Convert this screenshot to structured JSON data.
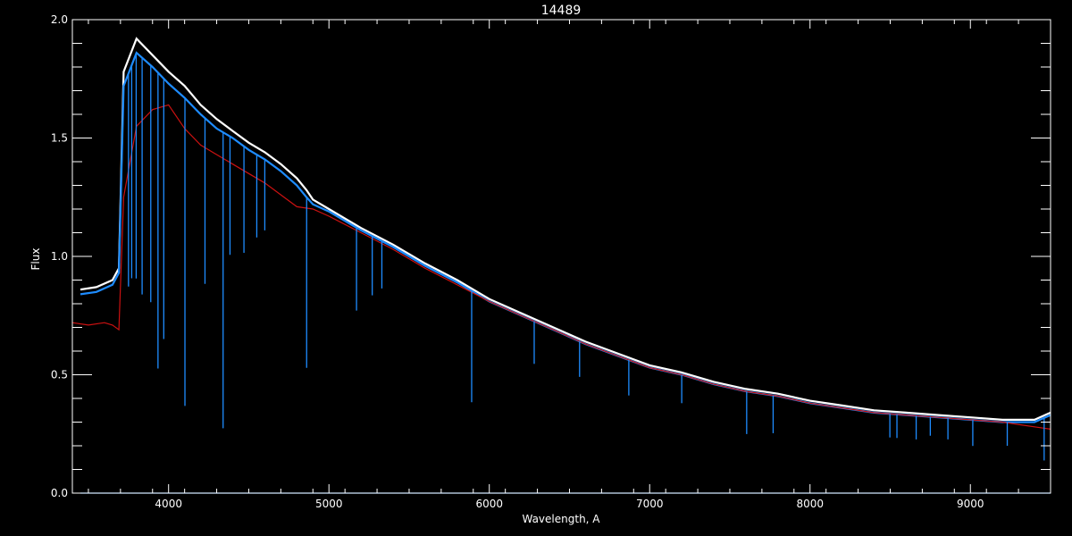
{
  "chart_data": {
    "type": "line",
    "title": "14489",
    "xlabel": "Wavelength, A",
    "ylabel": "Flux",
    "xlim": [
      3400,
      9500
    ],
    "ylim": [
      0.0,
      2.0
    ],
    "x_ticks": [
      4000,
      5000,
      6000,
      7000,
      8000,
      9000
    ],
    "x_tick_labels": [
      "4000",
      "5000",
      "6000",
      "7000",
      "8000",
      "9000"
    ],
    "y_ticks": [
      0.0,
      0.5,
      1.0,
      1.5,
      2.0
    ],
    "y_tick_labels": [
      "0.0",
      "0.5",
      "1.0",
      "1.5",
      "2.0"
    ],
    "grid": false,
    "colors": {
      "background": "#000000",
      "axes": "#ffffff",
      "observed_upper": "#ffffff",
      "observed": "#1e8cff",
      "model": "#cc1111",
      "error": "#1e8cff"
    },
    "series": [
      {
        "color": "#ffffff",
        "x": [
          3450,
          3550,
          3650,
          3690,
          3720,
          3800,
          3900,
          4000,
          4100,
          4200,
          4300,
          4400,
          4500,
          4600,
          4700,
          4800,
          4860,
          4900,
          5000,
          5200,
          5400,
          5600,
          5800,
          6000,
          6200,
          6400,
          6600,
          6800,
          7000,
          7200,
          7400,
          7600,
          7800,
          8000,
          8200,
          8400,
          8600,
          8800,
          9000,
          9200,
          9400,
          9500
        ],
        "y": [
          0.86,
          0.87,
          0.9,
          0.95,
          1.78,
          1.92,
          1.85,
          1.78,
          1.72,
          1.64,
          1.58,
          1.53,
          1.48,
          1.44,
          1.39,
          1.33,
          1.28,
          1.24,
          1.2,
          1.12,
          1.05,
          0.97,
          0.9,
          0.82,
          0.76,
          0.7,
          0.64,
          0.59,
          0.54,
          0.51,
          0.47,
          0.44,
          0.42,
          0.39,
          0.37,
          0.35,
          0.34,
          0.33,
          0.32,
          0.31,
          0.31,
          0.34
        ]
      },
      {
        "color": "#1e8cff",
        "x": [
          3450,
          3550,
          3650,
          3690,
          3720,
          3800,
          3900,
          4000,
          4100,
          4200,
          4300,
          4400,
          4500,
          4600,
          4700,
          4800,
          4860,
          4900,
          5000,
          5200,
          5400,
          5600,
          5800,
          6000,
          6200,
          6400,
          6600,
          6800,
          7000,
          7200,
          7400,
          7600,
          7800,
          8000,
          8200,
          8400,
          8600,
          8800,
          9000,
          9200,
          9400,
          9500
        ],
        "y": [
          0.84,
          0.85,
          0.88,
          0.93,
          1.72,
          1.86,
          1.8,
          1.73,
          1.67,
          1.6,
          1.54,
          1.5,
          1.45,
          1.41,
          1.36,
          1.3,
          1.25,
          1.22,
          1.19,
          1.11,
          1.04,
          0.96,
          0.89,
          0.81,
          0.75,
          0.69,
          0.63,
          0.58,
          0.53,
          0.5,
          0.46,
          0.43,
          0.41,
          0.38,
          0.36,
          0.34,
          0.33,
          0.32,
          0.31,
          0.3,
          0.3,
          0.33
        ]
      },
      {
        "color": "#cc1111",
        "x": [
          3400,
          3500,
          3600,
          3650,
          3690,
          3720,
          3800,
          3900,
          4000,
          4100,
          4200,
          4300,
          4400,
          4500,
          4600,
          4700,
          4800,
          4900,
          5000,
          5200,
          5400,
          5600,
          5800,
          6000,
          6200,
          6400,
          6600,
          6800,
          7000,
          7200,
          7400,
          7600,
          7800,
          8000,
          8200,
          8400,
          8600,
          8800,
          9000,
          9200,
          9400,
          9500
        ],
        "y": [
          0.72,
          0.71,
          0.72,
          0.71,
          0.69,
          1.25,
          1.55,
          1.62,
          1.64,
          1.54,
          1.47,
          1.43,
          1.39,
          1.35,
          1.31,
          1.26,
          1.21,
          1.2,
          1.17,
          1.1,
          1.03,
          0.95,
          0.88,
          0.81,
          0.75,
          0.69,
          0.63,
          0.58,
          0.53,
          0.5,
          0.46,
          0.43,
          0.41,
          0.38,
          0.36,
          0.34,
          0.33,
          0.32,
          0.31,
          0.3,
          0.28,
          0.27
        ]
      },
      {
        "color": "#1e8cff",
        "x": [
          3450,
          9500
        ],
        "y": [
          0.0,
          0.0
        ]
      }
    ],
    "absorption_lines": [
      {
        "x": 3750,
        "depth": 0.9
      },
      {
        "x": 3770,
        "depth": 0.9
      },
      {
        "x": 3798,
        "depth": 0.95
      },
      {
        "x": 3835,
        "depth": 1.0
      },
      {
        "x": 3889,
        "depth": 1.0
      },
      {
        "x": 3934,
        "depth": 1.25
      },
      {
        "x": 3970,
        "depth": 1.1
      },
      {
        "x": 4102,
        "depth": 1.3
      },
      {
        "x": 4227,
        "depth": 0.7
      },
      {
        "x": 4340,
        "depth": 1.25
      },
      {
        "x": 4383,
        "depth": 0.5
      },
      {
        "x": 4470,
        "depth": 0.45
      },
      {
        "x": 4550,
        "depth": 0.35
      },
      {
        "x": 4600,
        "depth": 0.3
      },
      {
        "x": 4861,
        "depth": 0.72
      },
      {
        "x": 5172,
        "depth": 0.35
      },
      {
        "x": 5270,
        "depth": 0.25
      },
      {
        "x": 5330,
        "depth": 0.2
      },
      {
        "x": 5890,
        "depth": 0.47
      },
      {
        "x": 6280,
        "depth": 0.18
      },
      {
        "x": 6563,
        "depth": 0.15
      },
      {
        "x": 6870,
        "depth": 0.15
      },
      {
        "x": 7200,
        "depth": 0.12
      },
      {
        "x": 7605,
        "depth": 0.18
      },
      {
        "x": 7770,
        "depth": 0.16
      },
      {
        "x": 8498,
        "depth": 0.1
      },
      {
        "x": 8542,
        "depth": 0.1
      },
      {
        "x": 8662,
        "depth": 0.1
      },
      {
        "x": 8750,
        "depth": 0.08
      },
      {
        "x": 8860,
        "depth": 0.09
      },
      {
        "x": 9015,
        "depth": 0.11
      },
      {
        "x": 9230,
        "depth": 0.1
      },
      {
        "x": 9460,
        "depth": 0.18
      }
    ]
  }
}
